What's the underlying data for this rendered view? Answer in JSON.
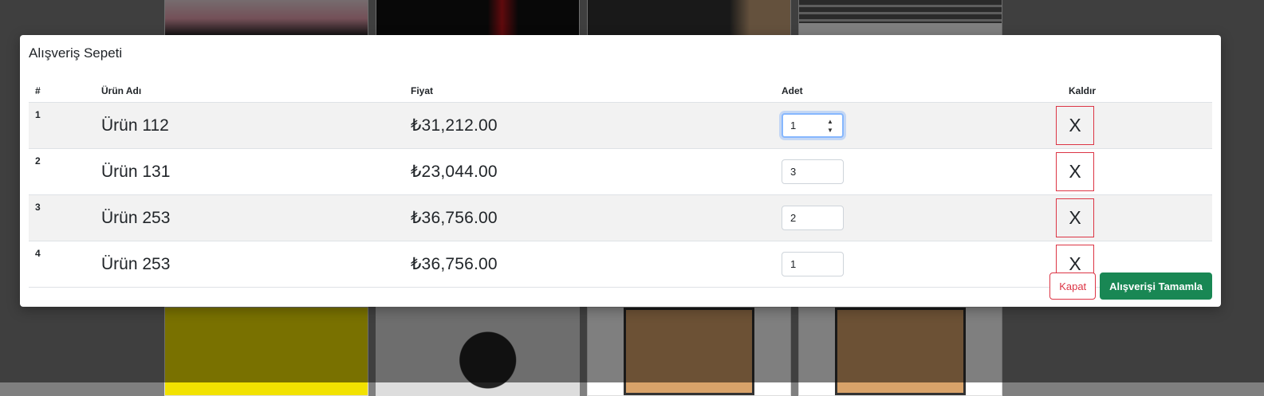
{
  "modal": {
    "title": "Alışveriş Sepeti",
    "columns": [
      "#",
      "Ürün Adı",
      "Fiyat",
      "Adet",
      "Kaldır"
    ],
    "rows": [
      {
        "index": "1",
        "name": "Ürün 112",
        "price": "₺31,212.00",
        "qty": "1"
      },
      {
        "index": "2",
        "name": "Ürün 131",
        "price": "₺23,044.00",
        "qty": "3"
      },
      {
        "index": "3",
        "name": "Ürün 253",
        "price": "₺36,756.00",
        "qty": "2"
      },
      {
        "index": "4",
        "name": "Ürün 253",
        "price": "₺36,756.00",
        "qty": "1"
      }
    ],
    "remove_label": "X",
    "close_label": "Kapat",
    "checkout_label": "Alışverişi Tamamla"
  },
  "colors": {
    "danger": "#dc3545",
    "success": "#198754",
    "focus_ring": "#86b7fe"
  },
  "icons": {
    "spin_up": "spin-up-icon",
    "spin_down": "spin-down-icon"
  }
}
